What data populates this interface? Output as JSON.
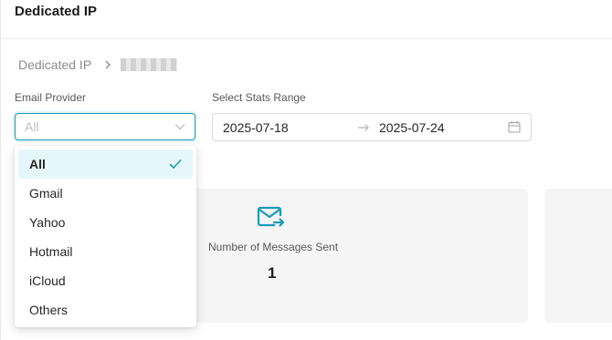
{
  "page": {
    "title": "Dedicated IP"
  },
  "breadcrumb": {
    "root": "Dedicated IP"
  },
  "filters": {
    "email_provider": {
      "label": "Email Provider",
      "placeholder": "All"
    },
    "stats_range": {
      "label": "Select Stats Range",
      "start": "2025-07-18",
      "end": "2025-07-24"
    }
  },
  "dropdown": {
    "options": [
      "All",
      "Gmail",
      "Yahoo",
      "Hotmail",
      "iCloud",
      "Others"
    ],
    "selected": "All"
  },
  "stats": {
    "messages_sent": {
      "label": "Number of Messages Sent",
      "value": "1",
      "icon": "mail-send-icon"
    }
  },
  "colors": {
    "accent": "#1a9bb8",
    "card_bg": "#f5f5f6",
    "selected_bg": "#e6f7fb"
  }
}
